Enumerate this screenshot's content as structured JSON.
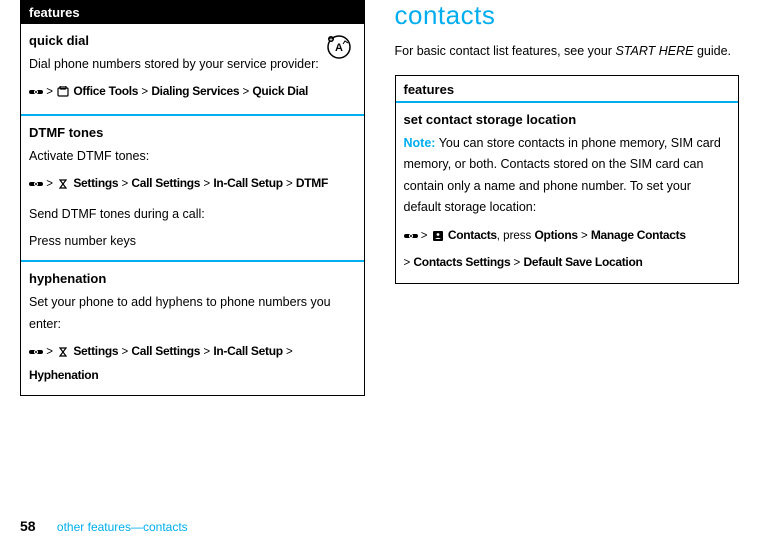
{
  "left": {
    "header": "features",
    "rows": [
      {
        "title": "quick dial",
        "body": "Dial phone numbers stored by your service provider:",
        "path_items": [
          "Office Tools",
          "Dialing Services",
          "Quick Dial"
        ]
      },
      {
        "title": "DTMF tones",
        "body": "Activate DTMF tones:",
        "path_items": [
          "Settings",
          "Call Settings",
          "In-Call Setup",
          "DTMF"
        ],
        "body2": "Send DTMF tones during a call:",
        "body3": "Press number keys"
      },
      {
        "title": "hyphenation",
        "body": "Set your phone to add hyphens to phone numbers you enter:",
        "path_items": [
          "Settings",
          "Call Settings",
          "In-Call Setup",
          "Hyphenation"
        ]
      }
    ]
  },
  "right": {
    "section_title": "contacts",
    "intro_pre": "For basic contact list features, see your ",
    "intro_em": "START HERE",
    "intro_post": " guide.",
    "header": "features",
    "row": {
      "title": "set contact storage location",
      "note_label": "Note:",
      "note_body": " You can store contacts in phone memory, SIM card memory, or both. Contacts stored on the SIM card can contain only a name and phone number. To set your default storage location:",
      "path_item1": "Contacts",
      "path_press": ", press ",
      "path_item2": "Options",
      "path_item3": "Manage Contacts",
      "path_item4": "Contacts Settings",
      "path_item5": "Default Save Location"
    }
  },
  "footer": {
    "page": "58",
    "text": "other features—contacts"
  },
  "sep": " > "
}
